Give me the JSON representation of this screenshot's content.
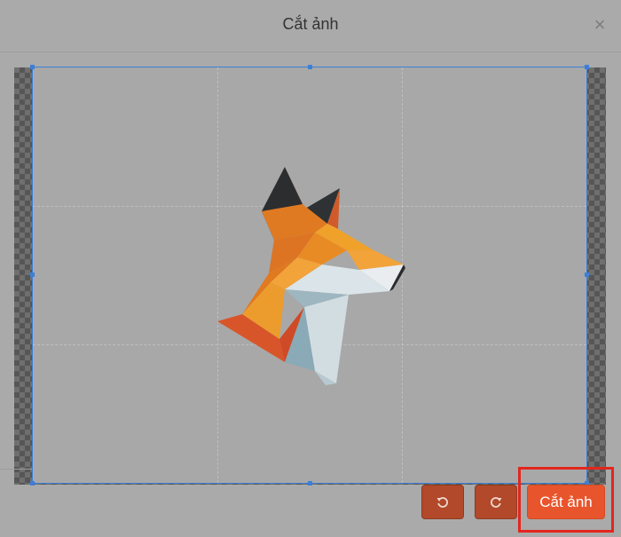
{
  "modal": {
    "title": "Cắt ảnh",
    "close_icon": "close-icon",
    "close_glyph": "×"
  },
  "editor": {
    "image_subject": "low-poly fox head",
    "checkerboard_colors": [
      "#565656",
      "#6f6f6f"
    ],
    "crop_border_color": "#3d7fd6"
  },
  "toolbar": {
    "rotate_left_icon": "rotate-left-icon",
    "rotate_right_icon": "rotate-right-icon",
    "crop_label": "Cắt ảnh",
    "accent_color": "#e8552d",
    "highlight_color": "#e3261f"
  }
}
